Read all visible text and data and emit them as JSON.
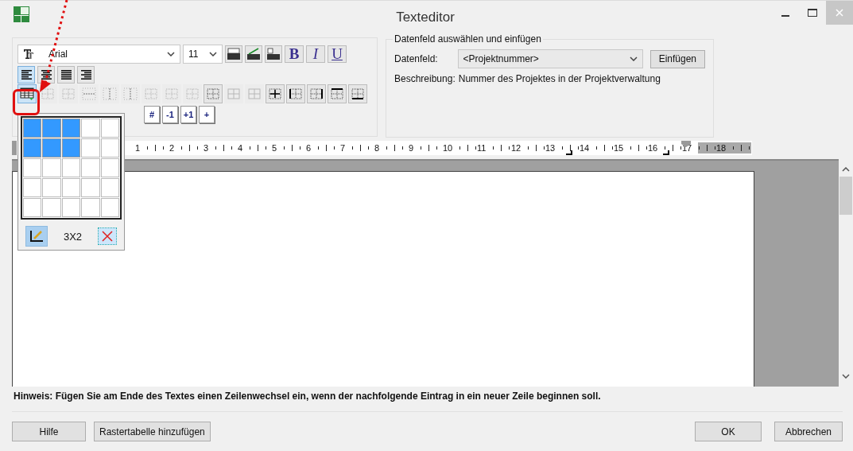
{
  "window": {
    "title": "Texteditor"
  },
  "format_toolbar": {
    "font": {
      "value": "Arial"
    },
    "size": {
      "value": "11"
    },
    "text_style_buttons": [
      {
        "label": "B",
        "kind": "bold"
      },
      {
        "label": "I",
        "kind": "italic"
      },
      {
        "label": "U",
        "kind": "underline"
      }
    ],
    "alignment_buttons": [
      {
        "selected": true
      },
      {
        "selected": false
      },
      {
        "selected": false
      },
      {
        "selected": false
      }
    ],
    "table_buttons": [
      {
        "selected": true,
        "disabled": false
      },
      {
        "selected": false,
        "disabled": true
      },
      {
        "selected": false,
        "disabled": true
      },
      {
        "selected": false,
        "disabled": true
      },
      {
        "selected": false,
        "disabled": true
      },
      {
        "selected": false,
        "disabled": true
      },
      {
        "selected": false,
        "disabled": true
      },
      {
        "selected": false,
        "disabled": true
      },
      {
        "selected": false,
        "disabled": true
      },
      {
        "selected": false,
        "disabled": false
      },
      {
        "selected": false,
        "disabled": true
      },
      {
        "selected": false,
        "disabled": true
      },
      {
        "selected": false,
        "disabled": false
      },
      {
        "selected": false,
        "disabled": false
      },
      {
        "selected": false,
        "disabled": false
      },
      {
        "selected": false,
        "disabled": false
      },
      {
        "selected": false,
        "disabled": false
      }
    ],
    "page_buttons": [
      {
        "label": "#"
      },
      {
        "label": "-1"
      },
      {
        "label": "+1"
      },
      {
        "label": "+"
      }
    ]
  },
  "table_picker": {
    "rows": [
      [
        {
          "selected": true
        },
        {
          "selected": true
        },
        {
          "selected": true
        },
        {
          "selected": false
        },
        {
          "selected": false
        }
      ],
      [
        {
          "selected": true
        },
        {
          "selected": true
        },
        {
          "selected": true
        },
        {
          "selected": false
        },
        {
          "selected": false
        }
      ],
      [
        {
          "selected": false
        },
        {
          "selected": false
        },
        {
          "selected": false
        },
        {
          "selected": false
        },
        {
          "selected": false
        }
      ],
      [
        {
          "selected": false
        },
        {
          "selected": false
        },
        {
          "selected": false
        },
        {
          "selected": false
        },
        {
          "selected": false
        }
      ],
      [
        {
          "selected": false
        },
        {
          "selected": false
        },
        {
          "selected": false
        },
        {
          "selected": false
        },
        {
          "selected": false
        }
      ]
    ],
    "size_label": "3X2",
    "draw_button": {
      "selected": true
    }
  },
  "data_field_group": {
    "legend": "Datenfeld auswählen und einfügen",
    "label": "Datenfeld:",
    "value": "<Projektnummer>",
    "insert_button": "Einfügen",
    "description_label": "Beschreibung:",
    "description": "Nummer des Projektes in der Projektverwaltung"
  },
  "ruler": {
    "numbers": [
      "1",
      "2",
      "3",
      "4",
      "5",
      "6",
      "7",
      "8",
      "9",
      "10",
      "11",
      "12",
      "13",
      "14",
      "15",
      "16",
      "17",
      "18"
    ]
  },
  "hint": "Hinweis: Fügen Sie am Ende des Textes einen Zeilenwechsel ein, wenn der nachfolgende Eintrag in ein neuer Zeile beginnen soll.",
  "buttons": {
    "help": "Hilfe",
    "grid_table": "Rastertabelle hinzufügen",
    "ok": "OK",
    "cancel": "Abbrechen"
  }
}
